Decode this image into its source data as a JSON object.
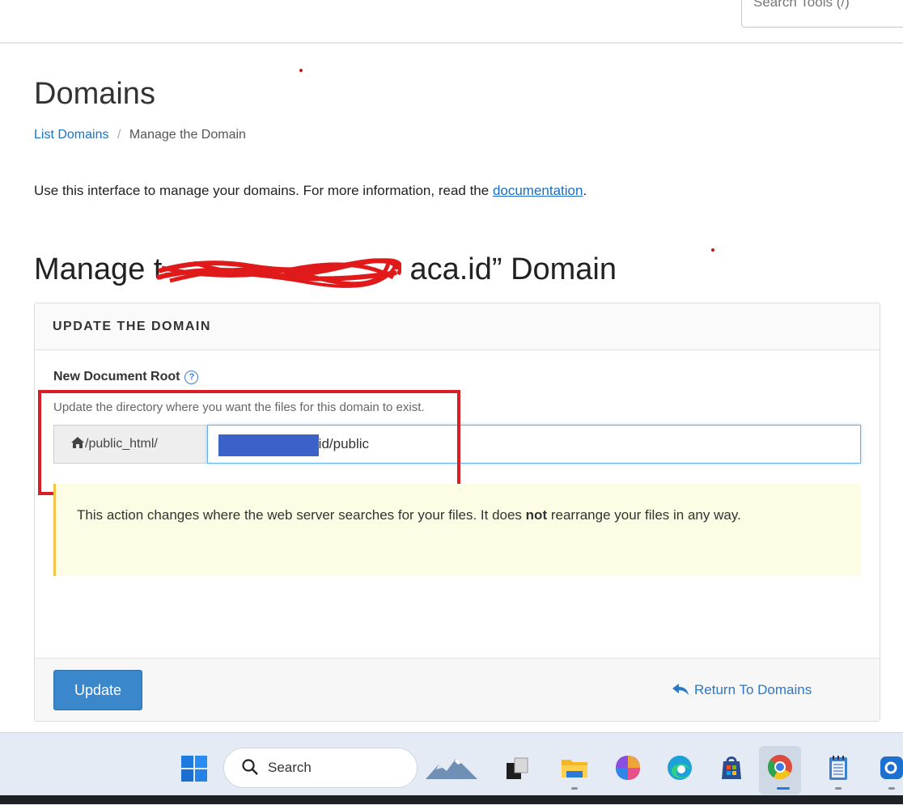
{
  "topbar": {
    "search_tools_placeholder": "Search Tools (/)"
  },
  "page": {
    "title": "Domains",
    "breadcrumb": {
      "link": "List Domains",
      "separator": "/",
      "current": "Manage the Domain"
    },
    "intro_text": "Use this interface to manage your domains. For more information, read the ",
    "intro_link": "documentation",
    "intro_end": "."
  },
  "manage": {
    "title_prefix": "Manage t",
    "title_suffix": "aca.id” Domain"
  },
  "panel": {
    "header": "UPDATE THE DOMAIN",
    "doc_root_label": "New Document Root",
    "doc_root_help": "Update the directory where you want the files for this domain to exist.",
    "addon_text": "/public_html/",
    "input_value": "ca.id/public",
    "notice_part1": "This action changes where the web server searches for your files. It does ",
    "notice_bold": "not",
    "notice_part2": " rearrange your files in any way.",
    "update_button": "Update",
    "return_link": "Return To Domains"
  },
  "taskbar": {
    "search_label": "Search"
  },
  "colors": {
    "accent": "#3b87cc",
    "link": "#2a78c8",
    "highlight_box": "#d81f26",
    "notice_bg": "#fdfde6",
    "notice_border": "#f3c34a"
  }
}
